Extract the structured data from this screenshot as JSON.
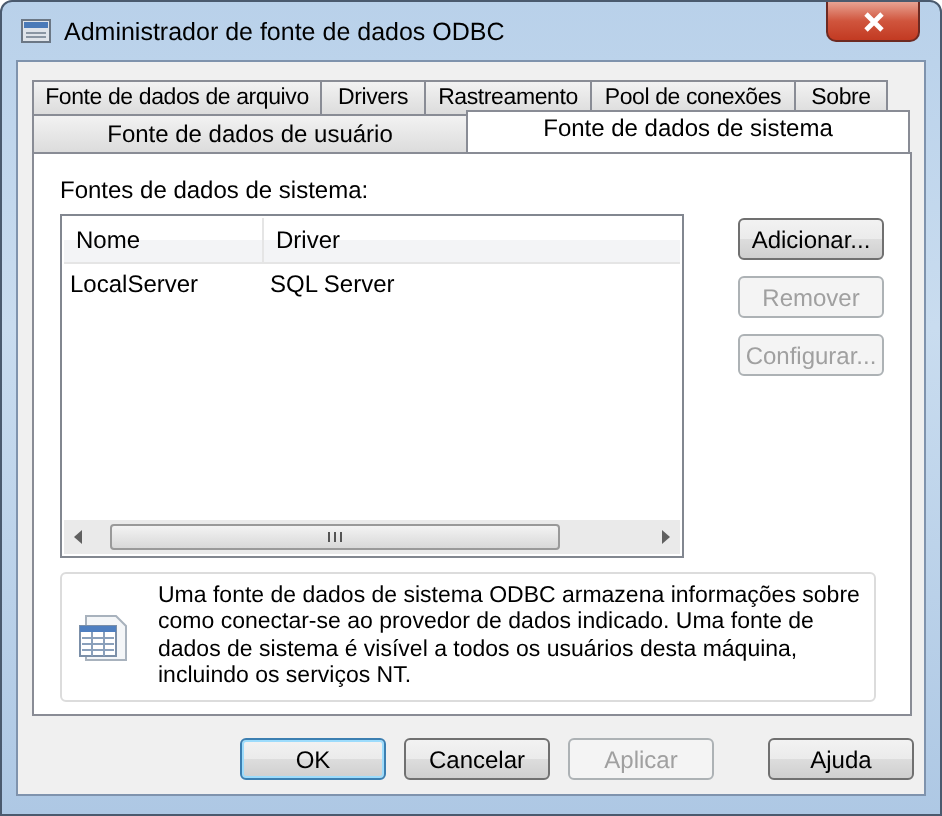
{
  "window": {
    "title": "Administrador de fonte de dados ODBC"
  },
  "tabs_row_1": [
    {
      "label": "Fonte de dados de arquivo",
      "selected": false
    },
    {
      "label": "Drivers",
      "selected": false
    },
    {
      "label": "Rastreamento",
      "selected": false
    },
    {
      "label": "Pool de conexões",
      "selected": false
    },
    {
      "label": "Sobre",
      "selected": false
    }
  ],
  "tabs_row_2": [
    {
      "label": "Fonte de dados de usuário",
      "selected": false
    },
    {
      "label": "Fonte de dados de sistema",
      "selected": true
    }
  ],
  "list_label": "Fontes de dados de sistema:",
  "table": {
    "columns": [
      "Nome",
      "Driver"
    ],
    "rows": [
      [
        "LocalServer",
        "SQL Server"
      ]
    ]
  },
  "side_buttons": [
    {
      "label": "Adicionar...",
      "disabled": false
    },
    {
      "label": "Remover",
      "disabled": true
    },
    {
      "label": "Configurar...",
      "disabled": true
    }
  ],
  "info_text": "Uma fonte de dados de sistema ODBC armazena informações sobre como conectar-se ao provedor de dados indicado. Uma fonte de dados de sistema é visível a todos os usuários desta máquina, incluindo os serviços NT.",
  "buttons": [
    {
      "label": "OK",
      "default": true,
      "disabled": false
    },
    {
      "label": "Cancelar",
      "default": false,
      "disabled": false
    },
    {
      "label": "Aplicar",
      "default": false,
      "disabled": true
    },
    {
      "label": "Ajuda",
      "default": false,
      "disabled": false
    }
  ]
}
